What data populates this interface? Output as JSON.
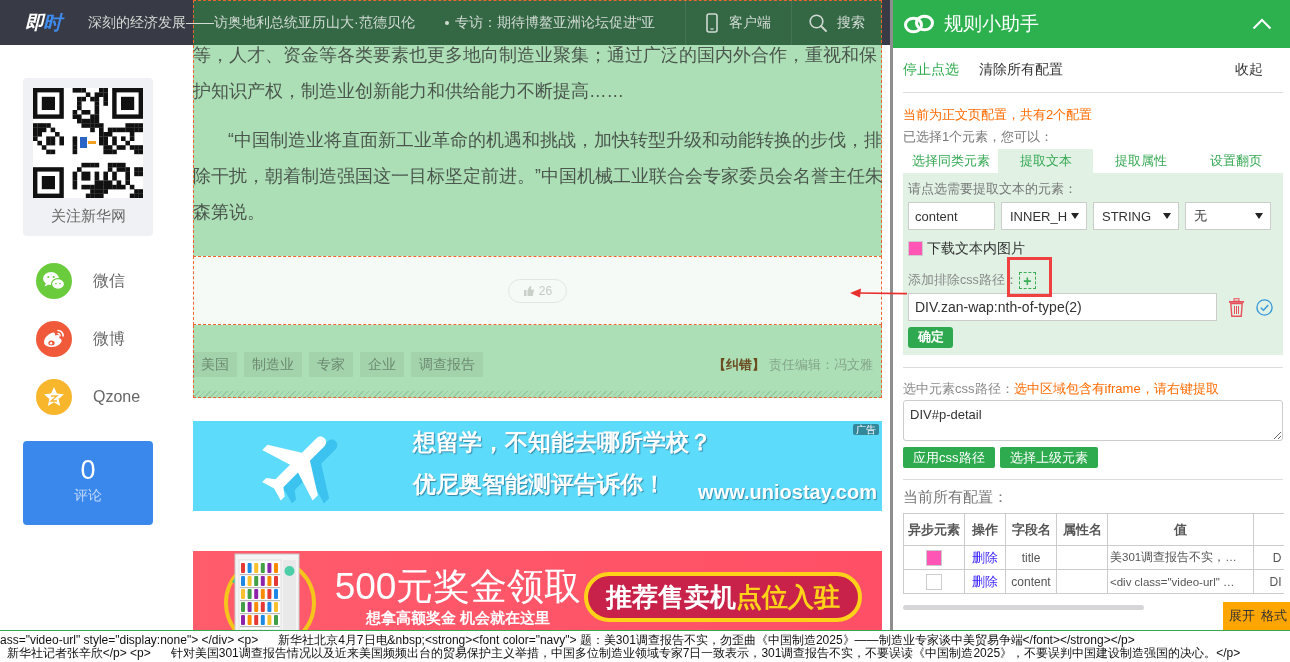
{
  "nav": {
    "logo": "即时",
    "headlines": [
      "深刻的经济发展——访奥地利总统亚历山大·范德贝伦",
      "专访：期待博鳌亚洲论坛促进“亚"
    ],
    "links": [
      {
        "kind": "phone",
        "label": "客户端"
      },
      {
        "kind": "search",
        "label": "搜索"
      }
    ]
  },
  "sidebar": {
    "qr_caption": "关注新华网",
    "share": [
      {
        "kind": "wechat",
        "label": "微信"
      },
      {
        "kind": "weibo",
        "label": "微博"
      },
      {
        "kind": "qzone",
        "label": "Qzone"
      }
    ],
    "comments": {
      "count": "0",
      "label": "评论"
    }
  },
  "article": {
    "paragraphs": [
      {
        "indent": false,
        "lines": [
          "等，人才、资金等各类要素也更多地向制造业聚集；通过广泛的国内外合作，重视和保",
          "护知识产权，制造业创新能力和供给能力不断提高……"
        ]
      },
      {
        "indent": true,
        "lines": [
          "“中国制造业将直面新工业革命的机遇和挑战，加快转型升级和动能转换的步伐，排",
          "除干扰，朝着制造强国这一目标坚定前进。”中国机械工业联合会专家委员会名誉主任朱",
          "森第说。"
        ]
      }
    ],
    "like_count": "26",
    "tags": [
      "美国",
      "制造业",
      "专家",
      "企业",
      "调查报告"
    ],
    "report": "【纠错】",
    "editor": "责任编辑：冯文雅"
  },
  "ads": [
    {
      "kind": "study",
      "lines": [
        "想留学，不知能去哪所学校？",
        "优尼奥智能测评告诉你！"
      ],
      "url": "www.uniostay.com",
      "badge": "广告"
    },
    {
      "kind": "vending",
      "headline": "500元奖金领取",
      "subline": "想拿高额奖金 机会就在这里",
      "cta": "推荐售卖机",
      "cta_highlight": "点位入驻"
    }
  ],
  "panel": {
    "title": "规则小助手",
    "actions": [
      {
        "kind": "link",
        "label": "停止点选"
      },
      {
        "kind": "plain",
        "label": "清除所有配置"
      }
    ],
    "collapse": "收起",
    "notice": "当前为正文页配置，共有2个配置",
    "selection_info": "已选择1个元素，您可以：",
    "tabs": [
      {
        "label": "选择同类元素",
        "selected": false
      },
      {
        "label": "提取文本",
        "selected": true
      },
      {
        "label": "提取属性",
        "selected": false
      },
      {
        "label": "设置翻页",
        "selected": false
      }
    ],
    "extract": {
      "prompt": "请点选需要提取文本的元素：",
      "field_name": "content",
      "selects": [
        "INNER_H",
        "STRING",
        "无"
      ],
      "download_images": {
        "label": "下载文本内图片",
        "checked": true
      },
      "exclude_label": "添加排除css路径：",
      "add_button": "+",
      "exclude_path": "DIV.zan-wap:nth-of-type(2)",
      "confirm": "确定"
    },
    "css_path": {
      "label": "选中元素css路径：",
      "warning": "选中区域包含有iframe，请右键提取",
      "value": "DIV#p-detail",
      "buttons": [
        "应用css路径",
        "选择上级元素"
      ]
    },
    "configs": {
      "title": "当前所有配置：",
      "columns": [
        "异步元素",
        "操作",
        "字段名",
        "属性名",
        "值"
      ],
      "rows": [
        {
          "async": true,
          "action": "删除",
          "field": "title",
          "value": "美301调查报告不实，…",
          "column_6": "D"
        },
        {
          "async": false,
          "action": "删除",
          "field": "content",
          "value": "<div class=\"video-url\" …",
          "column_6": "DI"
        }
      ]
    },
    "toolbar": [
      "展开",
      "格式"
    ]
  },
  "code_preview": {
    "lines": [
      "ass=\"video-url\" style=\"display:none\"> </div> <p>      新华社北京4月7日电&nbsp;<strong><font color=\"navy\"> 题：美301调查报告不实，勿歪曲《中国制造2025》——制造业专家谈中美贸易争端</font></strong></p>",
      "  新华社记者张辛欣</p> <p>      针对美国301调查报告情况以及近来美国频频出台的贸易保护主义举措，中国多位制造业领域专家7日一致表示，301调查报告不实，不要误读《中国制造2025》，不要误判中国建设制造强国的决心。</p>"
    ]
  }
}
